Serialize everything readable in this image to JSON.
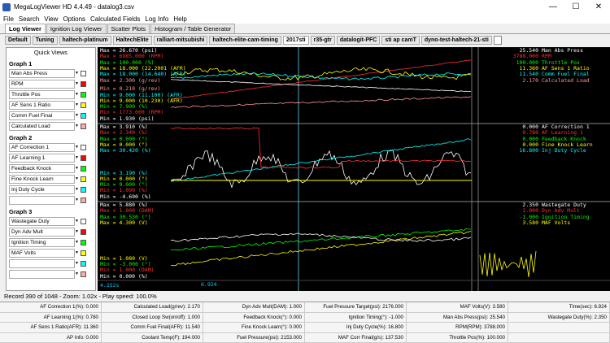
{
  "window": {
    "title": "MegaLogViewer HD 4.4.49 - datalog3.csv",
    "btn_min": "—",
    "btn_max": "☐",
    "btn_close": "✕"
  },
  "menu": [
    "File",
    "Search",
    "View",
    "Options",
    "Calculated Fields",
    "Log Info",
    "Help"
  ],
  "tabs": [
    {
      "label": "Log Viewer",
      "active": true
    },
    {
      "label": "Ignition Log Viewer"
    },
    {
      "label": "Scatter Plots"
    },
    {
      "label": "Histogram / Table Generator"
    }
  ],
  "project_tabs": [
    {
      "label": "Default"
    },
    {
      "label": "Tuning"
    },
    {
      "label": "haltech-platinum"
    },
    {
      "label": "HaltechElite"
    },
    {
      "label": "ralliart-mitsubishi"
    },
    {
      "label": "haltech-elite-cam-timing"
    },
    {
      "label": "2017sti",
      "active": true
    },
    {
      "label": "r35-gtr"
    },
    {
      "label": "datalogit-PFC"
    },
    {
      "label": "sti ap camT"
    },
    {
      "label": "dyno-test-haltech-21-sti"
    }
  ],
  "sidebar": {
    "title": "Quick Views",
    "graphs": [
      {
        "label": "Graph 1",
        "fields": [
          {
            "name": "Man Abs Press",
            "color": "#ffffff"
          },
          {
            "name": "RPM",
            "color": "#ff0000"
          },
          {
            "name": "Throttle Pos",
            "color": "#00ff00"
          },
          {
            "name": "AF Sens 1 Ratio",
            "color": "#ffff00"
          },
          {
            "name": "Comm Fuel Final",
            "color": "#00ffff"
          },
          {
            "name": "Calculated Load",
            "color": "#ffaaaa"
          }
        ]
      },
      {
        "label": "Graph 2",
        "fields": [
          {
            "name": "AF Correction 1",
            "color": "#ffffff"
          },
          {
            "name": "AF Learning 1",
            "color": "#ff0000"
          },
          {
            "name": "Feedback Knock",
            "color": "#00ff00"
          },
          {
            "name": "Fine Knock Learn",
            "color": "#ffff00"
          },
          {
            "name": "Inj Duty Cycle",
            "color": "#00ffff"
          },
          {
            "name": "",
            "color": "#ffaaaa"
          }
        ]
      },
      {
        "label": "Graph 3",
        "fields": [
          {
            "name": "Wastegate Duty",
            "color": "#ffffff"
          },
          {
            "name": "Dyn Adv Mult",
            "color": "#ff0000"
          },
          {
            "name": "Ignition Timing",
            "color": "#00ff00"
          },
          {
            "name": "MAF Volts",
            "color": "#ffff00"
          },
          {
            "name": "",
            "color": "#00ffff"
          },
          {
            "name": "",
            "color": "#ffaaaa"
          }
        ]
      }
    ]
  },
  "colors": {
    "white": "#ffffff",
    "red": "#ff3030",
    "green": "#00ff00",
    "yellow": "#ffff00",
    "cyan": "#00ffff",
    "pink": "#ff9999"
  },
  "chart": {
    "panels": [
      {
        "max": [
          [
            "Max = 26.670 (psi)",
            "white"
          ],
          [
            "Max = 6985.000 (RPM)",
            "red"
          ],
          [
            "Max = 100.000 (%)",
            "green"
          ],
          [
            "Max = 18.000 (22.2001 (AFR)",
            "yellow"
          ],
          [
            "Max = 18.000 (14.640) (AFR)",
            "cyan"
          ],
          [
            "Max = 2.300 (g/rev)",
            "pink"
          ]
        ],
        "min": [
          [
            "Min = 0.210 (g/rev)",
            "pink"
          ],
          [
            "Min = 9.000 (11.100) (AFR)",
            "cyan"
          ],
          [
            "Min = 9.000 (10.230) (AFR)",
            "yellow"
          ],
          [
            "Min = 7.900 (%)",
            "green"
          ],
          [
            "Min = 1773.000 (RPM)",
            "red"
          ],
          [
            "Min = 1.930 (psi)",
            "white"
          ]
        ],
        "right": [
          [
            "25.540",
            "Man Abs Press",
            "white"
          ],
          [
            "3788.000",
            "RPM",
            "red"
          ],
          [
            "100.000",
            "Throttle Pos",
            "green"
          ],
          [
            "11.360",
            "AF Sens 1 Ratio",
            "yellow"
          ],
          [
            "11.540",
            "Comm Fuel Final",
            "cyan"
          ],
          [
            "2.170",
            "Calculated Load",
            "pink"
          ]
        ]
      },
      {
        "max": [
          [
            "Max = 3.910 (%)",
            "white"
          ],
          [
            "Max = 2.340 (%)",
            "red"
          ],
          [
            "Max = 0.000 (°)",
            "green"
          ],
          [
            "Max = 0.000 (°)",
            "yellow"
          ],
          [
            "Max = 30.420 (%)",
            "cyan"
          ]
        ],
        "min": [
          [
            "Min = 3.190 (%)",
            "cyan"
          ],
          [
            "Min = 0.000 (°)",
            "yellow"
          ],
          [
            "Min = 0.000 (°)",
            "green"
          ],
          [
            "Min = 1.090 (%)",
            "red"
          ],
          [
            "Min = -4.690 (%)",
            "white"
          ]
        ],
        "right": [
          [
            "0.000",
            "AF Correction 1",
            "white"
          ],
          [
            "0.780",
            "AF Learning 1",
            "red"
          ],
          [
            "0.000",
            "Feedback Knock",
            "green"
          ],
          [
            "0.000",
            "Fine Knock Learn",
            "yellow"
          ],
          [
            "16.800",
            "Inj Duty Cycle",
            "cyan"
          ]
        ]
      },
      {
        "max": [
          [
            "Max = 5.880 (%)",
            "white"
          ],
          [
            "Max = 1.000 (DAM)",
            "red"
          ],
          [
            "Max = 30.530 (°)",
            "green"
          ],
          [
            "Max = 4.300 (V)",
            "yellow"
          ]
        ],
        "min": [
          [
            "Min = 1.080 (V)",
            "yellow"
          ],
          [
            "Min = -3.000 (°)",
            "green"
          ],
          [
            "Min = 1.000 (DAM)",
            "red"
          ],
          [
            "Min = 0.000 (%)",
            "white"
          ]
        ],
        "right": [
          [
            "2.350",
            "Wastegate Duty",
            "white"
          ],
          [
            "1.000",
            "Dyn Adv Mult",
            "red"
          ],
          [
            "-1.000",
            "Ignition Timing",
            "green"
          ],
          [
            "3.580",
            "MAF Volts",
            "yellow"
          ]
        ]
      }
    ],
    "time_start": "4.152s",
    "cursor_time": "6.924"
  },
  "status": {
    "record": "Record 390 of 1048 - Zoom: 1.02x - Play speed: 100.0%"
  },
  "readouts": [
    "AF Correction 1(%): 0.000",
    "Calculated Load(g/rev): 2.170",
    "Dyn Adv Mult(DAM): 1.000",
    "Fuel Pressure Target(psi): 2176.000",
    "MAF Volts(V): 3.580",
    "Time(sec): 6.924",
    "AF Learning 1(%): 0.780",
    "Closed Loop Sw(on/off): 1.000",
    "Feedback Knock(°): 0.000",
    "Ignition Timing(°): -1.000",
    "Man Abs Press(psi): 25.540",
    "Wastegate Duty(%): 2.350",
    "AF Sens 1 Ratio(AFR): 11.360",
    "Comm Fuel Final(AFR): 11.540",
    "Fine Knock Learn(°): 0.000",
    "Inj Duty Cycle(%): 16.800",
    "RPM(RPM): 3788.000",
    "",
    "AP Info: 0.000",
    "Coolant Temp(F): 194.000",
    "Fuel Pressure(psi): 2153.000",
    "MAF Corr Final(g/s): 137.530",
    "Throttle Pos(%): 100.000",
    ""
  ]
}
